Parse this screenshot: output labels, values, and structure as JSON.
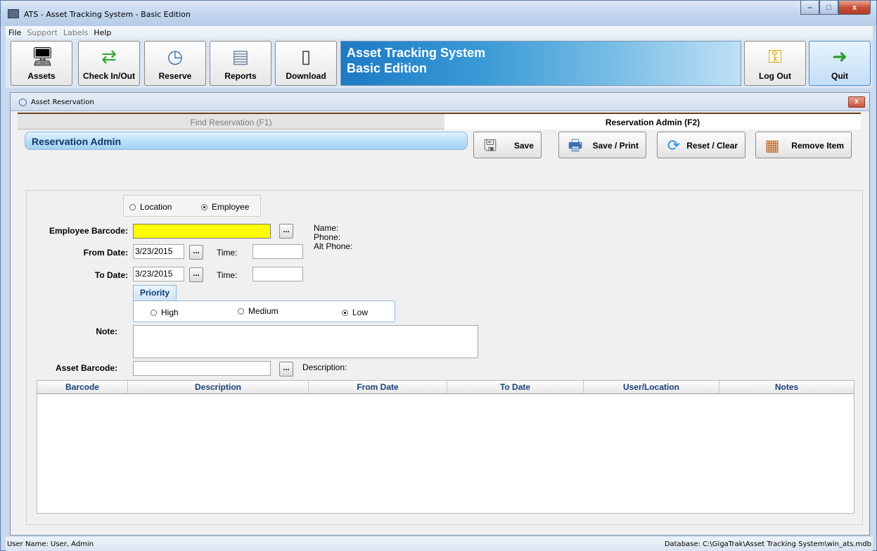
{
  "window": {
    "title": "ATS - Asset Tracking System - Basic Edition",
    "minimize": "–",
    "maximize": "□",
    "close": "x"
  },
  "menu": [
    "File",
    "Support",
    "Labels",
    "Help"
  ],
  "toolbar": {
    "assets": "Assets",
    "checkinout": "Check In/Out",
    "reserve": "Reserve",
    "reports": "Reports",
    "download": "Download",
    "banner_line1": "Asset Tracking System",
    "banner_line2": "Basic Edition",
    "logout": "Log Out",
    "quit": "Quit"
  },
  "child": {
    "title": "Asset Reservation",
    "close": "x"
  },
  "tabs": {
    "find": "Find Reservation (F1)",
    "admin": "Reservation Admin (F2)"
  },
  "section_title": "Reservation Admin",
  "actions": {
    "save": "Save",
    "save_print": "Save / Print",
    "reset": "Reset / Clear",
    "remove": "Remove Item"
  },
  "mode": {
    "location": "Location",
    "employee": "Employee",
    "selected": "employee"
  },
  "form": {
    "employee_barcode_label": "Employee Barcode:",
    "employee_barcode_value": "",
    "from_date_label": "From Date:",
    "from_date_value": "3/23/2015",
    "to_date_label": "To Date:",
    "to_date_value": "3/23/2015",
    "time_label": "Time:",
    "from_time_value": "",
    "to_time_value": "",
    "browse": "...",
    "name_label": "Name:",
    "phone_label": "Phone:",
    "alt_phone_label": "Alt Phone:",
    "priority_label": "Priority",
    "priority_options": [
      "High",
      "Medium",
      "Low"
    ],
    "priority_selected": "Low",
    "note_label": "Note:",
    "note_value": "",
    "asset_barcode_label": "Asset Barcode:",
    "asset_barcode_value": "",
    "description_label": "Description:"
  },
  "grid": {
    "columns": [
      "Barcode",
      "Description",
      "From Date",
      "To Date",
      "User/Location",
      "Notes"
    ],
    "rows": []
  },
  "status": {
    "user": "User Name:  User, Admin",
    "database": "Database:  C:\\GigaTrak\\Asset Tracking System\\win_ats.mdb"
  }
}
